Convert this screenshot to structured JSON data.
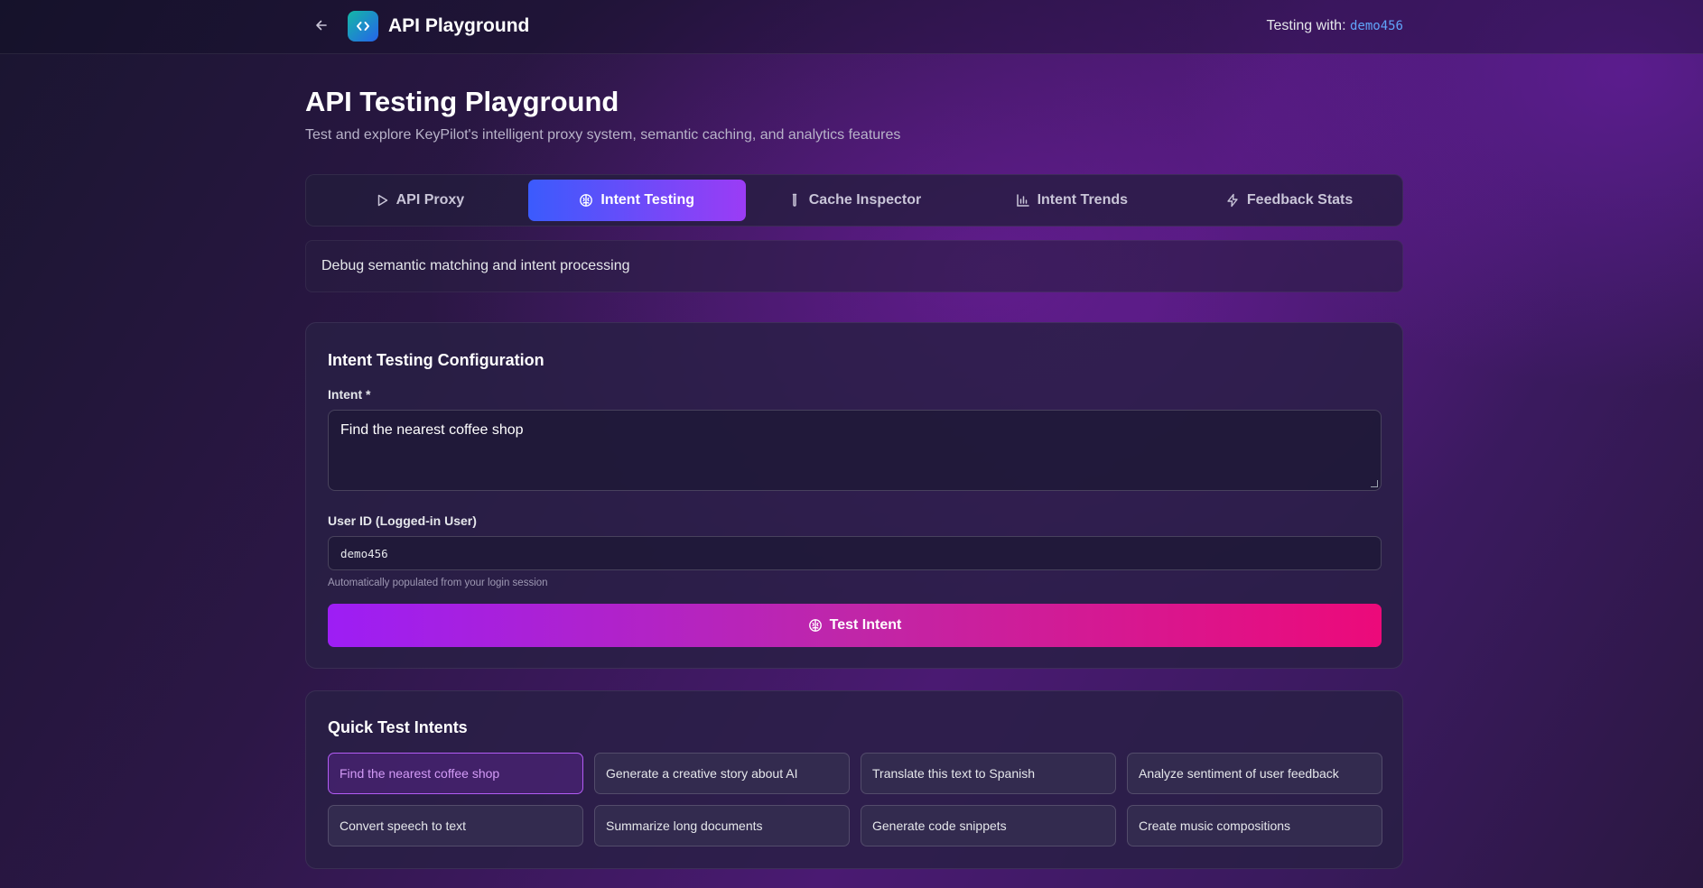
{
  "header": {
    "app_title": "API Playground",
    "testing_with_label": "Testing with:",
    "testing_with_user": "demo456"
  },
  "page": {
    "title": "API Testing Playground",
    "subtitle": "Test and explore KeyPilot's intelligent proxy system, semantic caching, and analytics features"
  },
  "tabs": [
    {
      "label": "API Proxy",
      "icon": "play-icon",
      "active": false
    },
    {
      "label": "Intent Testing",
      "icon": "brain-icon",
      "active": true
    },
    {
      "label": "Cache Inspector",
      "icon": "test-tube-icon",
      "active": false
    },
    {
      "label": "Intent Trends",
      "icon": "bar-chart-icon",
      "active": false
    },
    {
      "label": "Feedback Stats",
      "icon": "zap-icon",
      "active": false
    }
  ],
  "tab_description": "Debug semantic matching and intent processing",
  "config": {
    "title": "Intent Testing Configuration",
    "intent_label": "Intent *",
    "intent_value": "Find the nearest coffee shop",
    "user_id_label": "User ID (Logged-in User)",
    "user_id_value": "demo456",
    "user_id_hint": "Automatically populated from your login session",
    "submit_label": "Test Intent"
  },
  "quick": {
    "title": "Quick Test Intents",
    "items": [
      "Find the nearest coffee shop",
      "Generate a creative story about AI",
      "Translate this text to Spanish",
      "Analyze sentiment of user feedback",
      "Convert speech to text",
      "Summarize long documents",
      "Generate code snippets",
      "Create music compositions"
    ],
    "selected_index": 0
  },
  "colors": {
    "accent_blue": "#3b5bfd",
    "accent_purple": "#9b3cf5",
    "button_start": "#9d1ef5",
    "button_end": "#ec0a7a",
    "link_blue": "#60a5fa"
  }
}
